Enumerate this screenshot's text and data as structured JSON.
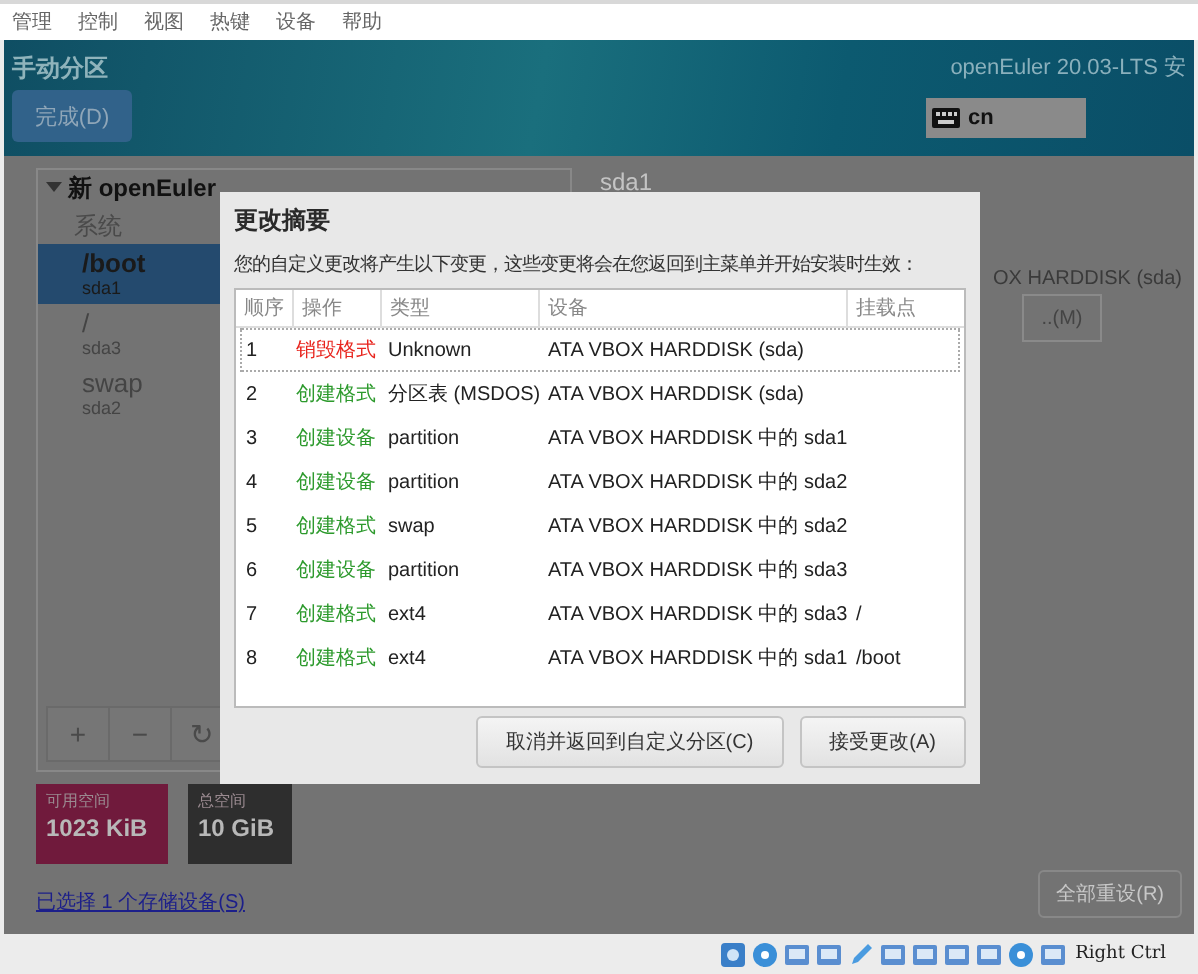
{
  "menu": [
    "管理",
    "控制",
    "视图",
    "热键",
    "设备",
    "帮助"
  ],
  "header": {
    "title": "手动分区",
    "done_button": "完成(D)",
    "product": "openEuler 20.03-LTS 安",
    "keyboard": "cn"
  },
  "left_panel": {
    "heading": "新 openEuler",
    "group": "系统",
    "items": [
      {
        "mount": "/boot",
        "device": "sda1",
        "selected": true
      },
      {
        "mount": "/",
        "device": "sda3",
        "selected": false
      },
      {
        "mount": "swap",
        "device": "sda2",
        "selected": false
      }
    ],
    "toolbar": [
      "+",
      "−",
      "↻"
    ],
    "free": {
      "label": "可用空间",
      "value": "1023 KiB"
    },
    "total": {
      "label": "总空间",
      "value": "10 GiB"
    },
    "link": "已选择 1 个存储设备(S)"
  },
  "right_panel": {
    "title": "sda1",
    "device": "OX HARDDISK (sda)",
    "modify_button": "..(M)",
    "reset_button": "全部重设(R)"
  },
  "dialog": {
    "title": "更改摘要",
    "description": "您的自定义更改将产生以下变更，这些变更将会在您返回到主菜单并开始安装时生效：",
    "columns": [
      "顺序",
      "操作",
      "类型",
      "设备",
      "挂载点"
    ],
    "rows": [
      {
        "order": "1",
        "action": "销毁格式",
        "kind": "destroy",
        "type": "Unknown",
        "device": "ATA VBOX HARDDISK (sda)",
        "mount": "",
        "selected": true
      },
      {
        "order": "2",
        "action": "创建格式",
        "kind": "create",
        "type": "分区表 (MSDOS)",
        "device": "ATA VBOX HARDDISK (sda)",
        "mount": "",
        "selected": false
      },
      {
        "order": "3",
        "action": "创建设备",
        "kind": "create",
        "type": "partition",
        "device": "ATA VBOX HARDDISK 中的 sda1",
        "mount": "",
        "selected": false
      },
      {
        "order": "4",
        "action": "创建设备",
        "kind": "create",
        "type": "partition",
        "device": "ATA VBOX HARDDISK 中的 sda2",
        "mount": "",
        "selected": false
      },
      {
        "order": "5",
        "action": "创建格式",
        "kind": "create",
        "type": "swap",
        "device": "ATA VBOX HARDDISK 中的 sda2",
        "mount": "",
        "selected": false
      },
      {
        "order": "6",
        "action": "创建设备",
        "kind": "create",
        "type": "partition",
        "device": "ATA VBOX HARDDISK 中的 sda3",
        "mount": "",
        "selected": false
      },
      {
        "order": "7",
        "action": "创建格式",
        "kind": "create",
        "type": "ext4",
        "device": "ATA VBOX HARDDISK 中的 sda3",
        "mount": "/",
        "selected": false
      },
      {
        "order": "8",
        "action": "创建格式",
        "kind": "create",
        "type": "ext4",
        "device": "ATA VBOX HARDDISK 中的 sda1",
        "mount": "/boot",
        "selected": false
      }
    ],
    "buttons": [
      "取消并返回到自定义分区(C)",
      "接受更改(A)"
    ]
  },
  "status_bar": {
    "host_key": "Right Ctrl"
  }
}
